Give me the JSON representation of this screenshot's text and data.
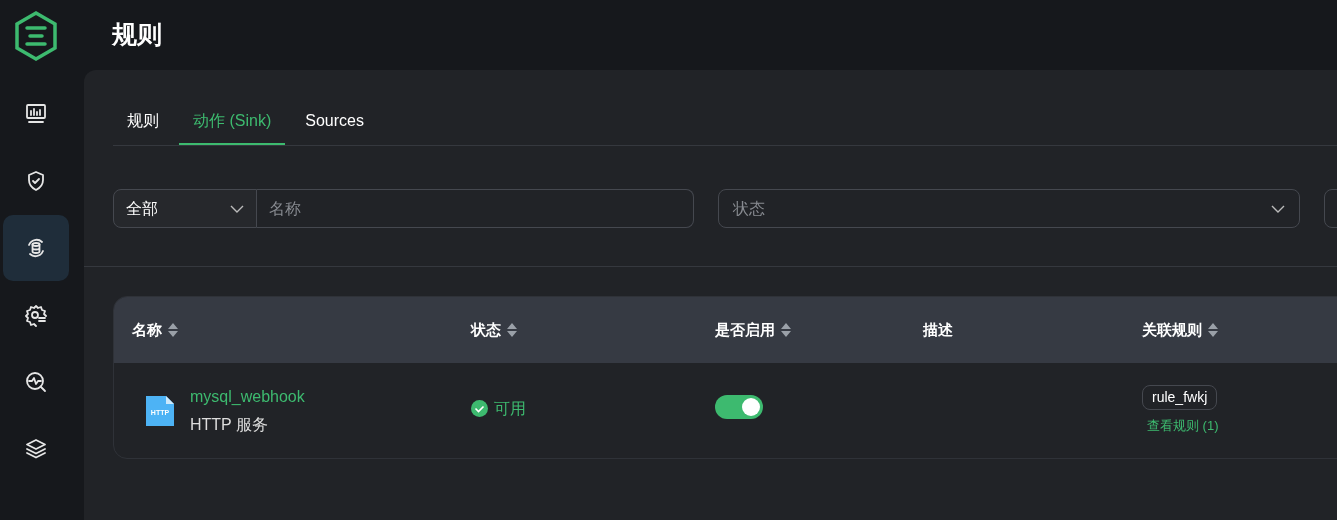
{
  "page_title": "规则",
  "sidebar": {
    "items": [
      {
        "selected": false
      },
      {
        "selected": false
      },
      {
        "selected": true
      },
      {
        "selected": false
      },
      {
        "selected": false
      },
      {
        "selected": false
      }
    ]
  },
  "tabs": [
    {
      "label": "规则",
      "selected": false
    },
    {
      "label": "动作 (Sink)",
      "selected": true
    },
    {
      "label": "Sources",
      "selected": false
    }
  ],
  "filters": {
    "type_select": {
      "value": "全部"
    },
    "name": {
      "placeholder": "名称"
    },
    "status": {
      "placeholder": "状态"
    }
  },
  "table": {
    "columns": [
      {
        "label": "名称",
        "sortable": true
      },
      {
        "label": "状态",
        "sortable": true
      },
      {
        "label": "是否启用",
        "sortable": true
      },
      {
        "label": "描述",
        "sortable": false
      },
      {
        "label": "关联规则",
        "sortable": true
      }
    ],
    "rows": [
      {
        "icon_label": "HTTP",
        "name": "mysql_webhook",
        "type": "HTTP 服务",
        "status": "可用",
        "enabled": true,
        "rule_tag": "rule_fwkj",
        "rule_link": "查看规则 (1)"
      }
    ]
  }
}
